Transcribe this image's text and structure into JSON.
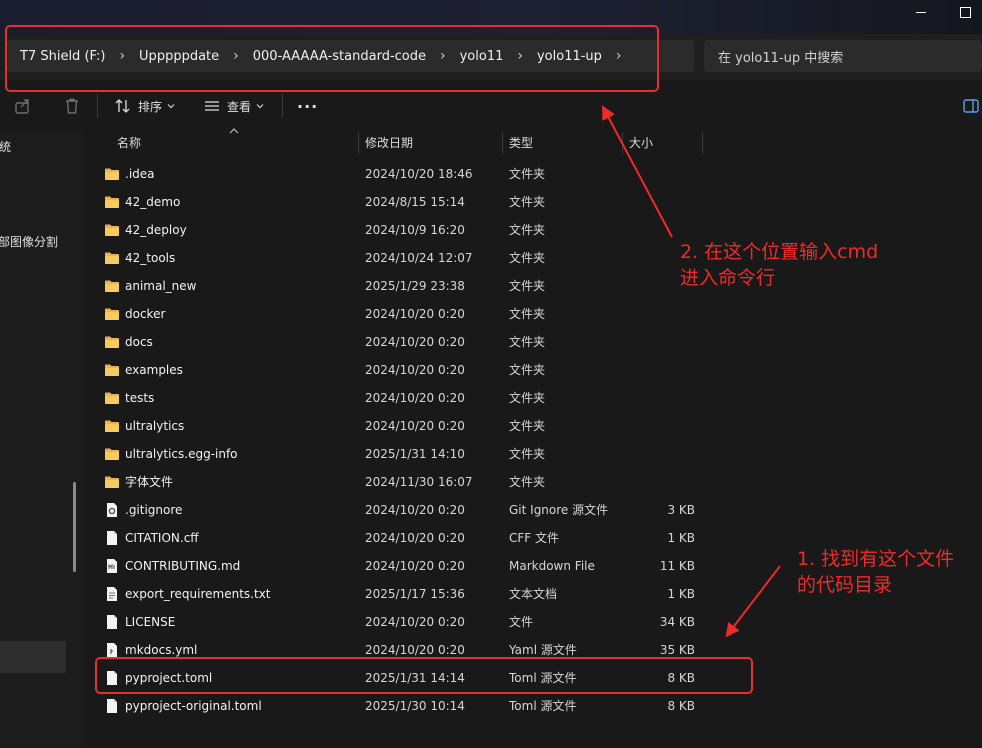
{
  "window": {
    "minimize_glyph": "—",
    "maximize_glyph": "☐"
  },
  "breadcrumb": {
    "items": [
      "T7 Shield (F:)",
      "Upppppdate",
      "000-AAAAA-standard-code",
      "yolo11",
      "yolo11-up"
    ],
    "separator": "›"
  },
  "search": {
    "placeholder": "在 yolo11-up 中搜索"
  },
  "toolbar": {
    "sort_label": "排序",
    "view_label": "查看",
    "more_label": "···"
  },
  "nav": {
    "items": [
      "系统",
      "肺部图像分割"
    ]
  },
  "columns": {
    "name": "名称",
    "date": "修改日期",
    "type": "类型",
    "size": "大小"
  },
  "files": [
    {
      "name": ".idea",
      "date": "2024/10/20 18:46",
      "type": "文件夹",
      "size": "",
      "icon": "folder-icon"
    },
    {
      "name": "42_demo",
      "date": "2024/8/15 15:14",
      "type": "文件夹",
      "size": "",
      "icon": "folder-icon"
    },
    {
      "name": "42_deploy",
      "date": "2024/10/9 16:20",
      "type": "文件夹",
      "size": "",
      "icon": "folder-icon"
    },
    {
      "name": "42_tools",
      "date": "2024/10/24 12:07",
      "type": "文件夹",
      "size": "",
      "icon": "folder-icon"
    },
    {
      "name": "animal_new",
      "date": "2025/1/29 23:38",
      "type": "文件夹",
      "size": "",
      "icon": "folder-icon"
    },
    {
      "name": "docker",
      "date": "2024/10/20 0:20",
      "type": "文件夹",
      "size": "",
      "icon": "folder-icon"
    },
    {
      "name": "docs",
      "date": "2024/10/20 0:20",
      "type": "文件夹",
      "size": "",
      "icon": "folder-icon"
    },
    {
      "name": "examples",
      "date": "2024/10/20 0:20",
      "type": "文件夹",
      "size": "",
      "icon": "folder-icon"
    },
    {
      "name": "tests",
      "date": "2024/10/20 0:20",
      "type": "文件夹",
      "size": "",
      "icon": "folder-icon"
    },
    {
      "name": "ultralytics",
      "date": "2024/10/20 0:20",
      "type": "文件夹",
      "size": "",
      "icon": "folder-icon"
    },
    {
      "name": "ultralytics.egg-info",
      "date": "2025/1/31 14:10",
      "type": "文件夹",
      "size": "",
      "icon": "folder-icon"
    },
    {
      "name": "字体文件",
      "date": "2024/11/30 16:07",
      "type": "文件夹",
      "size": "",
      "icon": "folder-icon"
    },
    {
      "name": ".gitignore",
      "date": "2024/10/20 0:20",
      "type": "Git Ignore 源文件",
      "size": "3 KB",
      "icon": "gear-file-icon"
    },
    {
      "name": "CITATION.cff",
      "date": "2024/10/20 0:20",
      "type": "CFF 文件",
      "size": "1 KB",
      "icon": "file-icon"
    },
    {
      "name": "CONTRIBUTING.md",
      "date": "2024/10/20 0:20",
      "type": "Markdown File",
      "size": "11 KB",
      "icon": "markdown-file-icon"
    },
    {
      "name": "export_requirements.txt",
      "date": "2025/1/17 15:36",
      "type": "文本文档",
      "size": "1 KB",
      "icon": "text-file-icon"
    },
    {
      "name": "LICENSE",
      "date": "2024/10/20 0:20",
      "type": "文件",
      "size": "34 KB",
      "icon": "file-icon"
    },
    {
      "name": "mkdocs.yml",
      "date": "2024/10/20 0:20",
      "type": "Yaml 源文件",
      "size": "35 KB",
      "icon": "yaml-file-icon"
    },
    {
      "name": "pyproject.toml",
      "date": "2025/1/31 14:14",
      "type": "Toml 源文件",
      "size": "8 KB",
      "icon": "file-icon"
    },
    {
      "name": "pyproject-original.toml",
      "date": "2025/1/30 10:14",
      "type": "Toml 源文件",
      "size": "8 KB",
      "icon": "file-icon"
    }
  ],
  "annotations": {
    "step2_line1": "2. 在这个位置输入cmd",
    "step2_line2": "进入命令行",
    "step1_line1": "1. 找到有这个文件",
    "step1_line2": "的代码目录",
    "color": "#ef2a2a"
  }
}
